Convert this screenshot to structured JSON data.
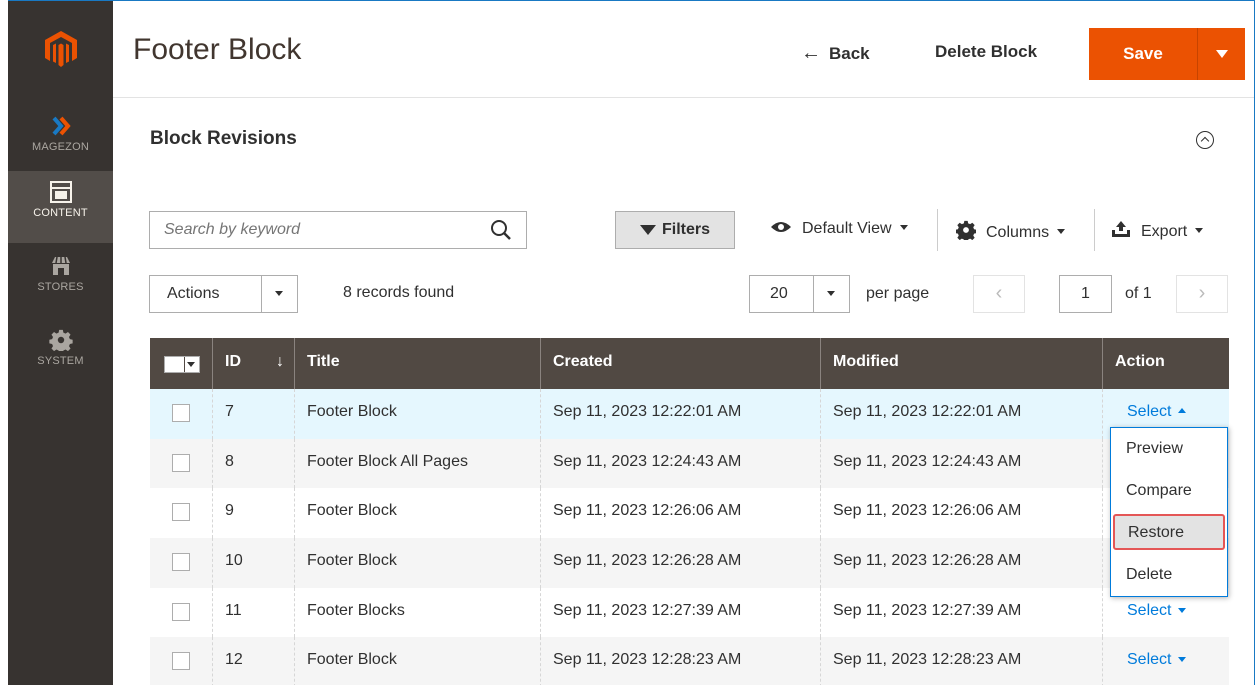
{
  "header": {
    "title": "Footer Block",
    "back_label": "Back",
    "delete_label": "Delete Block",
    "save_label": "Save"
  },
  "sidebar": {
    "items": [
      {
        "label": "MAGEZON",
        "icon": "magezon-icon"
      },
      {
        "label": "CONTENT",
        "icon": "content-icon",
        "active": true
      },
      {
        "label": "STORES",
        "icon": "stores-icon"
      },
      {
        "label": "SYSTEM",
        "icon": "gear-icon"
      }
    ]
  },
  "section": {
    "title": "Block Revisions"
  },
  "toolbar": {
    "search_placeholder": "Search by keyword",
    "filters_label": "Filters",
    "view_label": "Default View",
    "columns_label": "Columns",
    "export_label": "Export",
    "actions_label": "Actions",
    "records_found": "8 records found",
    "per_page_value": "20",
    "per_page_label": "per page",
    "page_value": "1",
    "page_of": "of 1"
  },
  "grid": {
    "columns": [
      "ID",
      "Title",
      "Created",
      "Modified",
      "Action"
    ],
    "rows": [
      {
        "id": "7",
        "title": "Footer Block",
        "created": "Sep 11, 2023 12:22:01 AM",
        "modified": "Sep 11, 2023 12:22:01 AM",
        "action": "Select"
      },
      {
        "id": "8",
        "title": "Footer Block All Pages",
        "created": "Sep 11, 2023 12:24:43 AM",
        "modified": "Sep 11, 2023 12:24:43 AM",
        "action": ""
      },
      {
        "id": "9",
        "title": "Footer Block",
        "created": "Sep 11, 2023 12:26:06 AM",
        "modified": "Sep 11, 2023 12:26:06 AM",
        "action": ""
      },
      {
        "id": "10",
        "title": "Footer Block",
        "created": "Sep 11, 2023 12:26:28 AM",
        "modified": "Sep 11, 2023 12:26:28 AM",
        "action": ""
      },
      {
        "id": "11",
        "title": "Footer Blocks",
        "created": "Sep 11, 2023 12:27:39 AM",
        "modified": "Sep 11, 2023 12:27:39 AM",
        "action": "Select"
      },
      {
        "id": "12",
        "title": "Footer Block",
        "created": "Sep 11, 2023 12:28:23 AM",
        "modified": "Sep 11, 2023 12:28:23 AM",
        "action": "Select"
      }
    ]
  },
  "action_menu": {
    "items": [
      "Preview",
      "Compare",
      "Restore",
      "Delete"
    ]
  },
  "colors": {
    "accent": "#eb5202",
    "sidebar_bg": "#373330",
    "grid_header_bg": "#514943",
    "link": "#007bdb",
    "highlight_border": "#e45656"
  }
}
